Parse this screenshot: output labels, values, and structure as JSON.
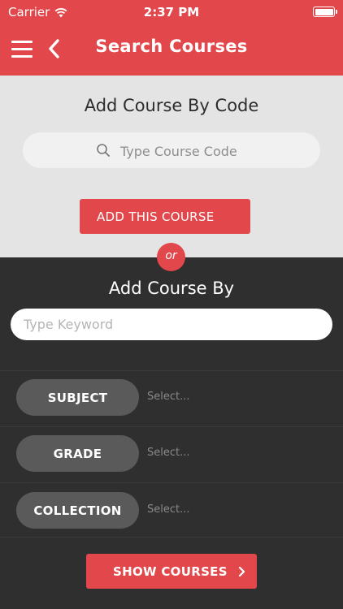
{
  "status_bar": {
    "carrier": "Carrier",
    "time": "2:37 PM"
  },
  "nav": {
    "title": "Search Courses"
  },
  "code_section": {
    "heading": "Add Course By Code",
    "search_placeholder": "Type Course Code",
    "add_button_label": "ADD THIS COURSE"
  },
  "divider_label": "or",
  "keyword_section": {
    "heading": "Add Course By",
    "keyword_placeholder": "Type Keyword"
  },
  "filters": [
    {
      "label": "SUBJECT",
      "value": "Select..."
    },
    {
      "label": "GRADE",
      "value": "Select..."
    },
    {
      "label": "COLLECTION",
      "value": "Select..."
    }
  ],
  "show_button_label": "SHOW COURSES",
  "colors": {
    "accent": "#e2474b",
    "dark_bg": "#2f2f2f",
    "light_bg": "#e4e4e4",
    "pill": "#5a5a5a"
  }
}
